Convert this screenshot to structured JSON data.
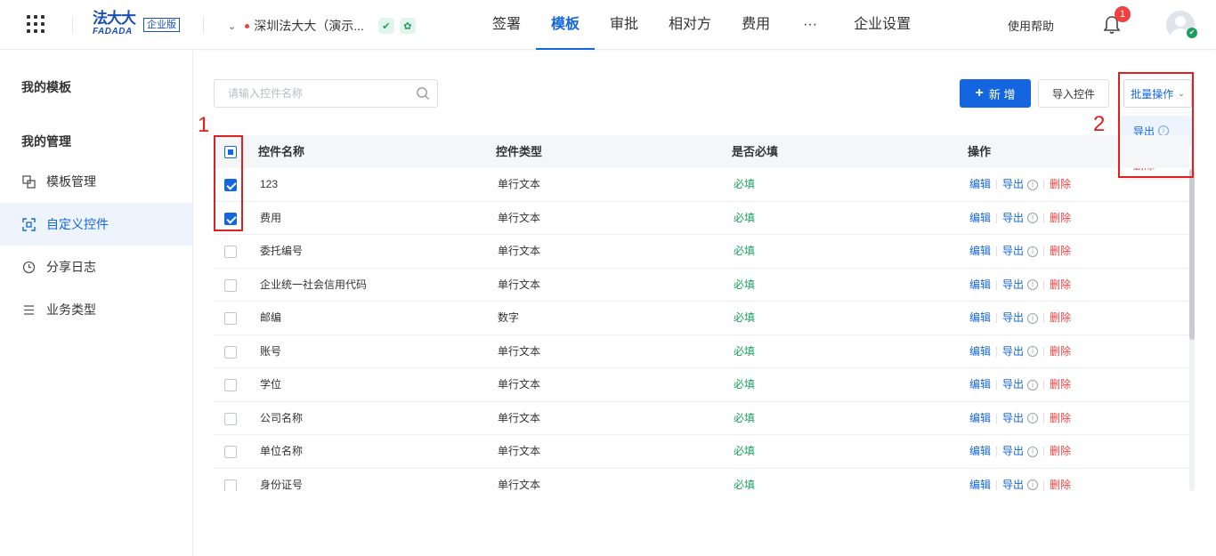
{
  "header": {
    "logo_cn": "法大大",
    "logo_en": "FADADA",
    "edition": "企业版",
    "company": "深圳法大大（演示...",
    "nav": [
      "签署",
      "模板",
      "审批",
      "相对方",
      "费用",
      "···",
      "企业设置"
    ],
    "active_nav": "模板",
    "help": "使用帮助",
    "notification_count": "1"
  },
  "sidebar": {
    "section_my_templates": "我的模板",
    "section_my_management": "我的管理",
    "items": [
      {
        "label": "模板管理",
        "icon": "template-manage-icon"
      },
      {
        "label": "自定义控件",
        "icon": "custom-control-icon"
      },
      {
        "label": "分享日志",
        "icon": "clock-icon"
      },
      {
        "label": "业务类型",
        "icon": "list-icon"
      }
    ],
    "active_item": "自定义控件"
  },
  "toolbar": {
    "search_placeholder": "请输入控件名称",
    "add_label": "新 增",
    "import_label": "导入控件",
    "batch_label": "批量操作"
  },
  "batch_menu": {
    "export": "导出",
    "delete": "删除"
  },
  "table": {
    "headers": [
      "控件名称",
      "控件类型",
      "是否必填",
      "操作"
    ],
    "op_edit": "编辑",
    "op_export": "导出",
    "op_delete": "删除",
    "rows": [
      {
        "name": "123",
        "type": "单行文本",
        "required": "必填",
        "checked": true
      },
      {
        "name": "费用",
        "type": "单行文本",
        "required": "必填",
        "checked": true
      },
      {
        "name": "委托编号",
        "type": "单行文本",
        "required": "必填",
        "checked": false
      },
      {
        "name": "企业统一社会信用代码",
        "type": "单行文本",
        "required": "必填",
        "checked": false
      },
      {
        "name": "邮编",
        "type": "数字",
        "required": "必填",
        "checked": false
      },
      {
        "name": "账号",
        "type": "单行文本",
        "required": "必填",
        "checked": false
      },
      {
        "name": "学位",
        "type": "单行文本",
        "required": "必填",
        "checked": false
      },
      {
        "name": "公司名称",
        "type": "单行文本",
        "required": "必填",
        "checked": false
      },
      {
        "name": "单位名称",
        "type": "单行文本",
        "required": "必填",
        "checked": false
      },
      {
        "name": "身份证号",
        "type": "单行文本",
        "required": "必填",
        "checked": false
      }
    ]
  },
  "annotations": [
    "1",
    "2"
  ],
  "colors": {
    "primary": "#1466e0",
    "danger": "#e84545",
    "success": "#17a05d",
    "annotation": "#e02020"
  }
}
